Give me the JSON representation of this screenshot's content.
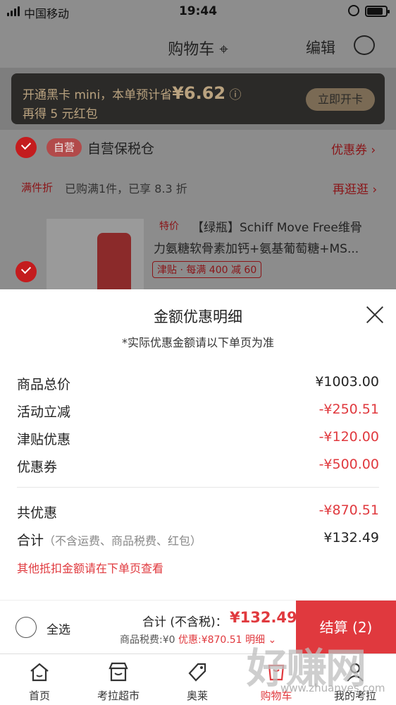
{
  "status_bar": {
    "carrier": "中国移动",
    "time": "19:44",
    "battery_level": 0.8
  },
  "nav": {
    "title": "购物车",
    "edit": "编辑"
  },
  "promo": {
    "line1_prefix": "开通黑卡 mini，本单预计省",
    "line1_amount": "¥6.62",
    "line2": "再得 5 元红包",
    "button": "立即开卡"
  },
  "store": {
    "tag": "自营",
    "name": "自营保税仓",
    "coupon": "优惠券 ›"
  },
  "discount_rule": {
    "tag": "满件折",
    "text": "已购满1件，已享 8.3 折",
    "more": "再逛逛 ›"
  },
  "product": {
    "badge": "特价",
    "title_line1": "【绿瓶】Schiff Move Free维骨",
    "title_line2": "力氨糖软骨素加钙+氨基葡萄糖+MS...",
    "tag": "津贴 · 每满 400 减 60"
  },
  "sheet": {
    "title": "金额优惠明细",
    "subtitle": "*实际优惠金额请以下单页为准",
    "rows": [
      {
        "label": "商品总价",
        "value": "¥1003.00"
      },
      {
        "label": "活动立减",
        "value": "-¥250.51"
      },
      {
        "label": "津贴优惠",
        "value": "-¥120.00"
      },
      {
        "label": "优惠券",
        "value": "-¥500.00"
      }
    ],
    "total_discount": {
      "label": "共优惠",
      "value": "-¥870.51"
    },
    "subtotal": {
      "label": "合计",
      "note": "（不含运费、商品税费、红包）",
      "value": "¥132.49"
    },
    "other_note": "其他抵扣金额请在下单页查看"
  },
  "checkout": {
    "select_all": "全选",
    "total_label": "合计 (不含税)：",
    "total_value": "¥132.49",
    "tax_text": "商品税费:¥0",
    "discount_text": "优惠:¥870.51",
    "detail": "明细 ⌄",
    "settle_button": "结算 (2)"
  },
  "tabs": [
    {
      "label": "首页",
      "icon": "home-icon"
    },
    {
      "label": "考拉超市",
      "icon": "store-icon"
    },
    {
      "label": "奥莱",
      "icon": "tag-icon"
    },
    {
      "label": "购物车",
      "icon": "cart-icon"
    },
    {
      "label": "我的考拉",
      "icon": "user-icon"
    }
  ],
  "watermark": {
    "text": "好赚网",
    "url": "www.zhuanyes.com"
  },
  "colors": {
    "accent": "#e0393e",
    "overlay": "#8a8a8a",
    "promo_gold": "#b9a27f"
  }
}
